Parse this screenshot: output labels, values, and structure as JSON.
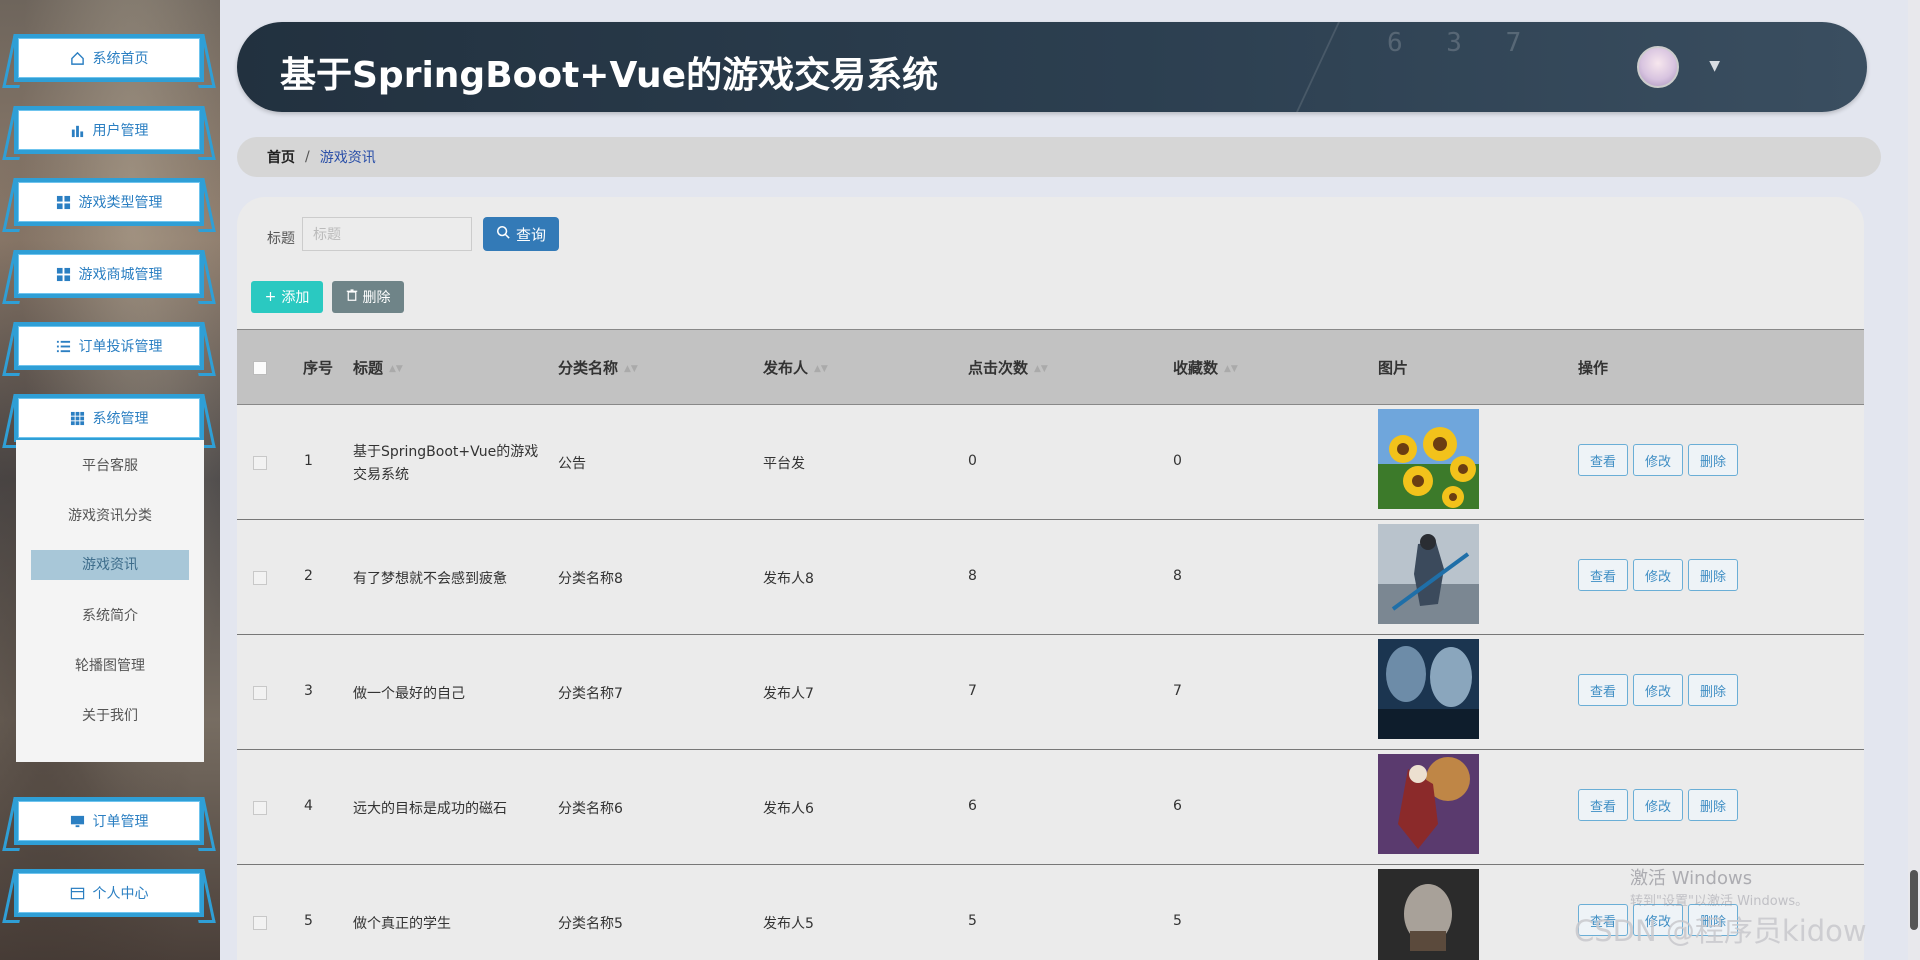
{
  "sidebar": {
    "menus": [
      {
        "label": "系统首页",
        "icon": "home-icon"
      },
      {
        "label": "用户管理",
        "icon": "bar-chart-icon"
      },
      {
        "label": "游戏类型管理",
        "icon": "grid-icon"
      },
      {
        "label": "游戏商城管理",
        "icon": "grid-icon"
      },
      {
        "label": "订单投诉管理",
        "icon": "list-icon"
      },
      {
        "label": "系统管理",
        "icon": "apps-icon"
      },
      {
        "label": "订单管理",
        "icon": "monitor-icon"
      },
      {
        "label": "个人中心",
        "icon": "card-icon"
      }
    ],
    "submenu": [
      "平台客服",
      "游戏资讯分类",
      "游戏资讯",
      "系统简介",
      "轮播图管理",
      "关于我们"
    ],
    "active_sub": "游戏资讯"
  },
  "header": {
    "title": "基于SpringBoot+Vue的游戏交易系统",
    "deco_digits": "6 3 7"
  },
  "breadcrumb": {
    "home": "首页",
    "separator": "/",
    "current": "游戏资讯"
  },
  "search": {
    "label": "标题",
    "placeholder": "标题",
    "value": "",
    "button": "查询"
  },
  "toolbar": {
    "add": "添加",
    "delete": "删除"
  },
  "table": {
    "headers": [
      "序号",
      "标题",
      "分类名称",
      "发布人",
      "点击次数",
      "收藏数",
      "图片",
      "操作"
    ],
    "rows": [
      {
        "no": "1",
        "title": "基于SpringBoot+Vue的游戏交易系统",
        "category": "公告",
        "publisher": "平台发",
        "clicks": "0",
        "favorites": "0",
        "image": "sunflowers"
      },
      {
        "no": "2",
        "title": "有了梦想就不会感到疲惫",
        "category": "分类名称8",
        "publisher": "发布人8",
        "clicks": "8",
        "favorites": "8",
        "image": "warrior-blue"
      },
      {
        "no": "3",
        "title": "做一个最好的自己",
        "category": "分类名称7",
        "publisher": "发布人7",
        "clicks": "7",
        "favorites": "7",
        "image": "biohazard-poster"
      },
      {
        "no": "4",
        "title": "远大的目标是成功的磁石",
        "category": "分类名称6",
        "publisher": "发布人6",
        "clicks": "6",
        "favorites": "6",
        "image": "fantasy-hero"
      },
      {
        "no": "5",
        "title": "做个真正的学生",
        "category": "分类名称5",
        "publisher": "发布人5",
        "clicks": "5",
        "favorites": "5",
        "image": "bald-warrior"
      }
    ],
    "actions": [
      "查看",
      "修改",
      "删除"
    ]
  },
  "watermark": {
    "line1": "激活 Windows",
    "line2": "转到\"设置\"以激活 Windows。",
    "csdn": "CSDN @程序员kidow"
  },
  "colors": {
    "accent": "#337ab7",
    "add": "#2ac9c1",
    "header": "#22313f",
    "sidebar_border": "#2f9fd6"
  }
}
